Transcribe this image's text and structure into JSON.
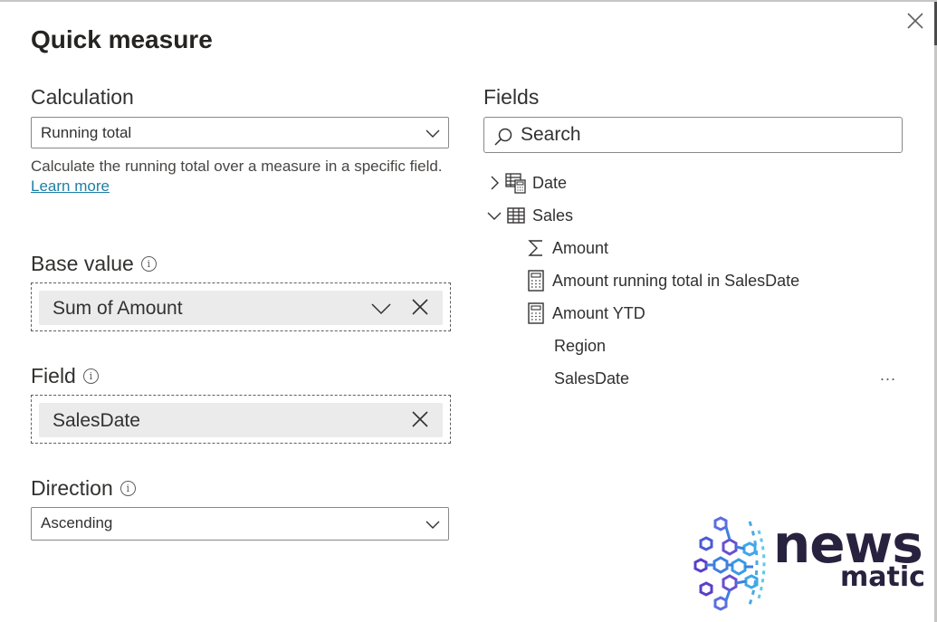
{
  "dialog": {
    "title": "Quick measure",
    "close_label": "Close"
  },
  "calculation": {
    "label": "Calculation",
    "selected": "Running total",
    "description": "Calculate the running total over a measure in a specific field.",
    "learn_more": "Learn more"
  },
  "base_value": {
    "label": "Base value",
    "value": "Sum of Amount"
  },
  "field": {
    "label": "Field",
    "value": "SalesDate"
  },
  "direction": {
    "label": "Direction",
    "selected": "Ascending"
  },
  "fields_panel": {
    "label": "Fields",
    "search_placeholder": "Search",
    "tables": [
      {
        "name": "Date",
        "expanded": false,
        "icon": "calculated-table-icon"
      },
      {
        "name": "Sales",
        "expanded": true,
        "icon": "table-icon",
        "items": [
          {
            "name": "Amount",
            "icon": "sigma-icon"
          },
          {
            "name": "Amount running total in SalesDate",
            "icon": "calculator-icon"
          },
          {
            "name": "Amount YTD",
            "icon": "calculator-icon"
          },
          {
            "name": "Region",
            "icon": ""
          },
          {
            "name": "SalesDate",
            "icon": ""
          }
        ]
      }
    ],
    "more_label": "..."
  },
  "watermark": {
    "line1": "news",
    "line2": "matic"
  },
  "colors": {
    "link": "#1e7fa5",
    "pill_bg": "#ebebeb",
    "text": "#323130",
    "border": "#8a8886"
  }
}
